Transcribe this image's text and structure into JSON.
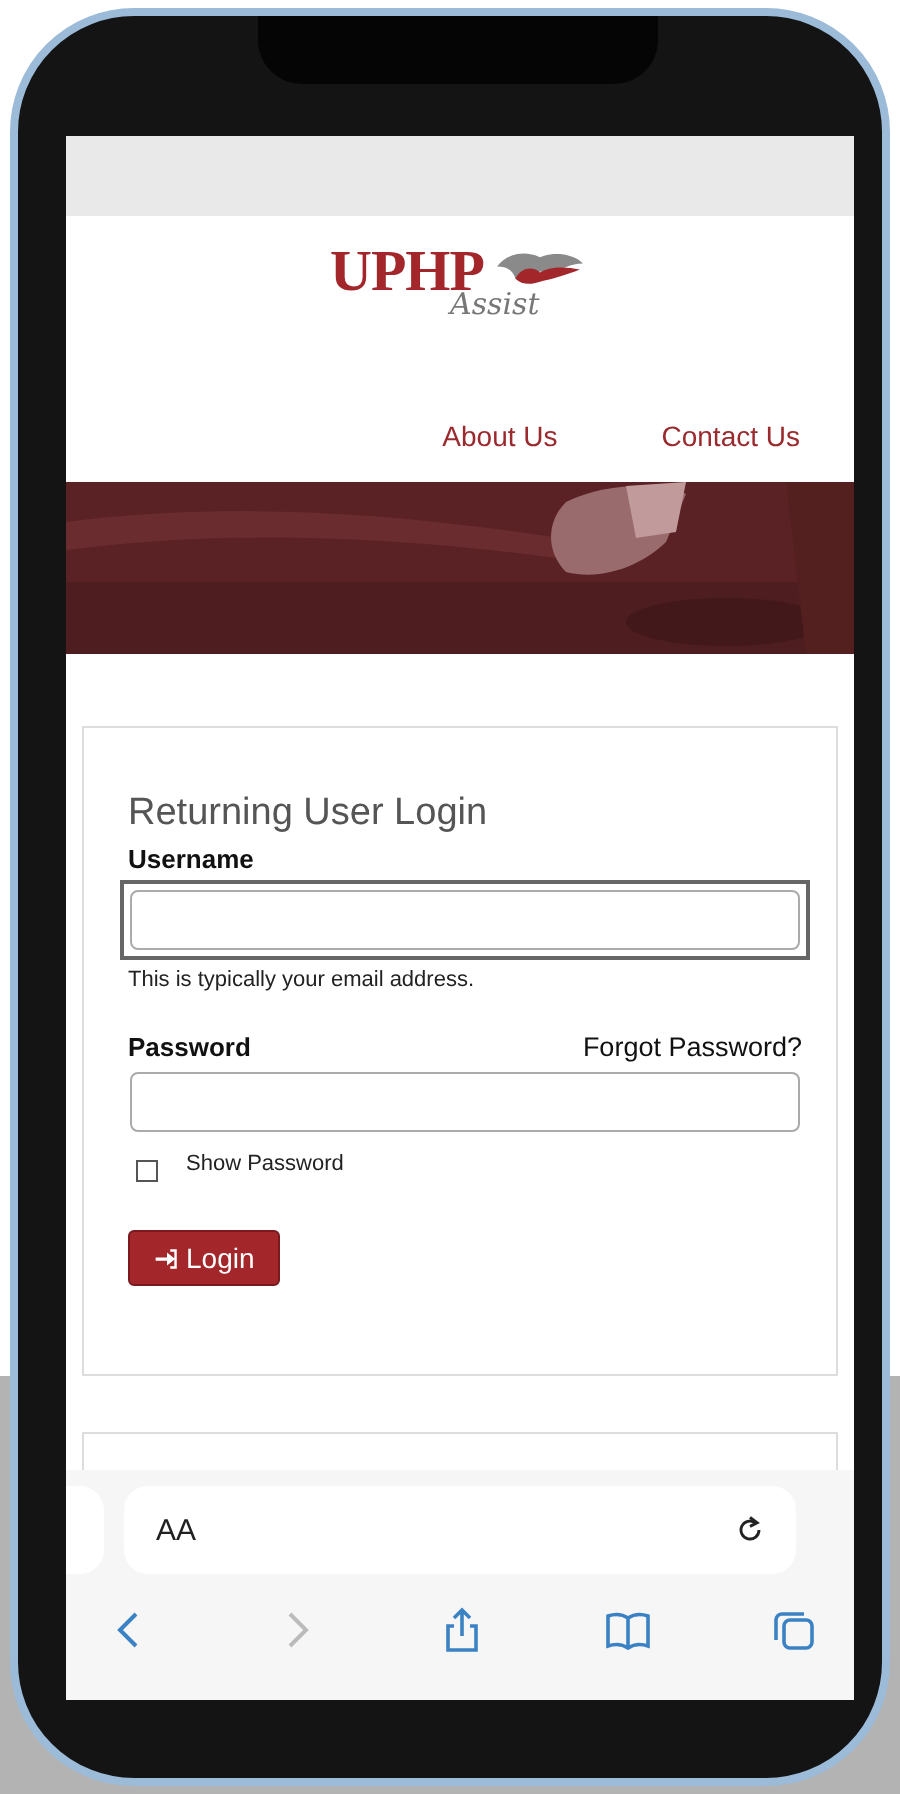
{
  "site": {
    "logo": {
      "title": "UPHP",
      "subtitle": "Assist"
    },
    "nav": [
      {
        "label": "About Us"
      },
      {
        "label": "Contact Us"
      }
    ]
  },
  "login": {
    "title": "Returning User Login",
    "username": {
      "label": "Username",
      "hint": "This is typically your email address.",
      "focused": true
    },
    "password": {
      "label": "Password",
      "forgot_link": "Forgot Password?",
      "focused": false
    },
    "show_password": {
      "label": "Show Password",
      "checked": false
    },
    "button": "Login"
  },
  "browser": {
    "text_size_button": "AA",
    "back_enabled": true,
    "forward_enabled": false
  }
}
